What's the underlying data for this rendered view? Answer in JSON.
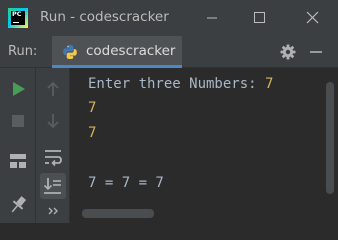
{
  "window": {
    "title": "Run - codescracker",
    "icons": [
      "pycharm-logo",
      "minimize-icon",
      "maximize-icon",
      "close-icon"
    ]
  },
  "run_panel": {
    "label": "Run:",
    "tab_label": "codescracker",
    "tab_icon": "python-icon",
    "right_icons": [
      "gear-icon",
      "hide-panel-icon"
    ]
  },
  "left_toolbar": [
    "rerun-icon",
    "up-arrow-icon",
    "stop-icon",
    "down-arrow-icon",
    "layout-icon",
    "soft-wrap-icon",
    "scroll-to-end-icon",
    "print-icon",
    "pin-icon",
    "more-icon"
  ],
  "console": {
    "prompt": "Enter three Numbers: ",
    "input1": "7",
    "input2": "7",
    "input3": "7",
    "result": "7 = 7 = 7"
  },
  "colors": {
    "background": "#2b2b2b",
    "panel": "#3c3f41",
    "text": "#a9b7c6",
    "user_input": "#d5b45b",
    "accent": "#4a88c7",
    "run_green": "#499c54"
  }
}
